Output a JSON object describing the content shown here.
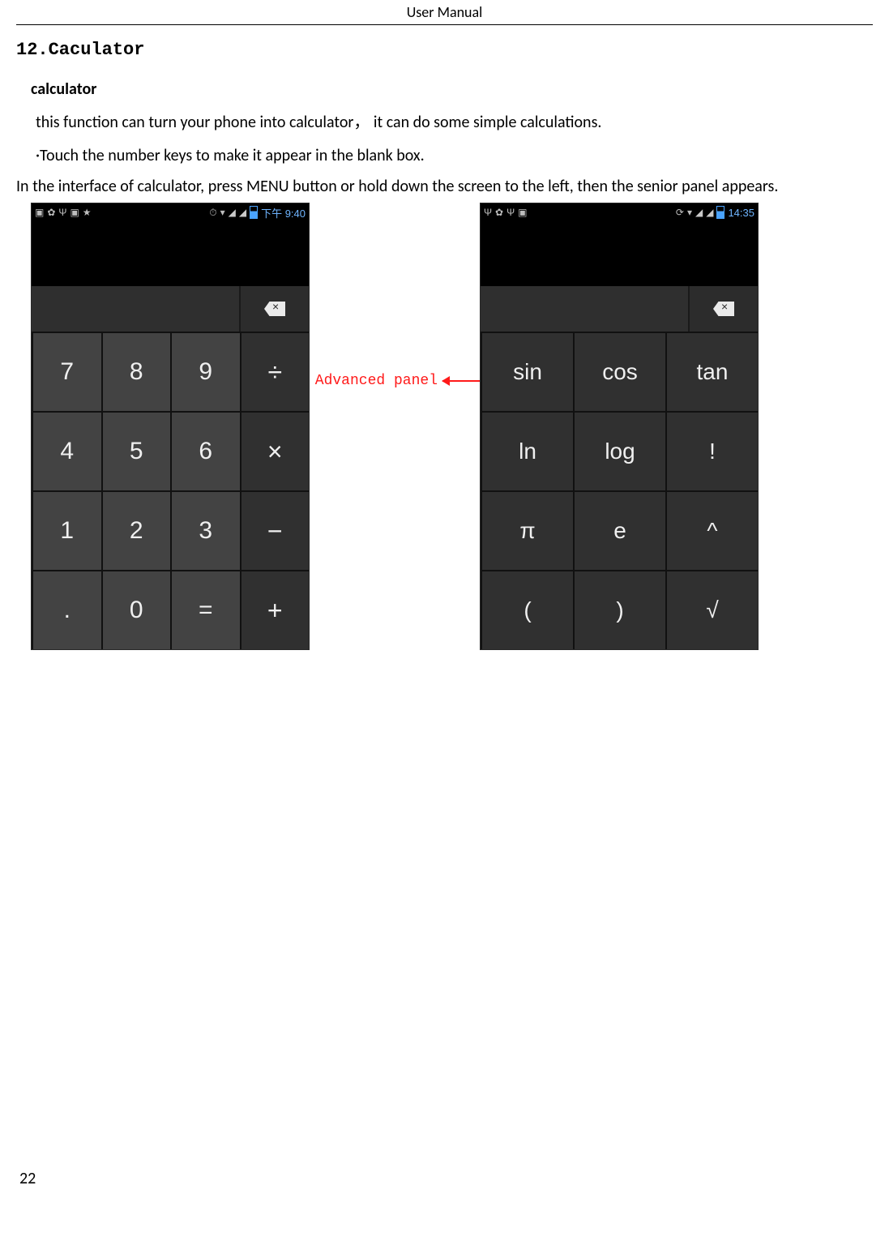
{
  "header": {
    "title": "User    Manual"
  },
  "section": {
    "number": "12.",
    "title": "Caculator"
  },
  "content": {
    "subheading": "calculator",
    "intro": "this function can turn your phone into calculator，   it can do some simple calculations.",
    "bullet": "·Touch the number keys to make it appear in the blank box.",
    "instruction": "In the interface of calculator, press MENU button or hold down the screen to the left, then the senior panel appears."
  },
  "annotation": {
    "label": "Advanced panel"
  },
  "phone_basic": {
    "time": "下午 9:40",
    "rows": [
      [
        "7",
        "8",
        "9",
        "÷"
      ],
      [
        "4",
        "5",
        "6",
        "×"
      ],
      [
        "1",
        "2",
        "3",
        "−"
      ],
      [
        ".",
        "0",
        "=",
        "+"
      ]
    ]
  },
  "phone_adv": {
    "time": "14:35",
    "rows": [
      [
        "sin",
        "cos",
        "tan"
      ],
      [
        "ln",
        "log",
        "!"
      ],
      [
        "π",
        "e",
        "^"
      ],
      [
        "(",
        ")",
        "√"
      ]
    ]
  },
  "page_number": "22"
}
